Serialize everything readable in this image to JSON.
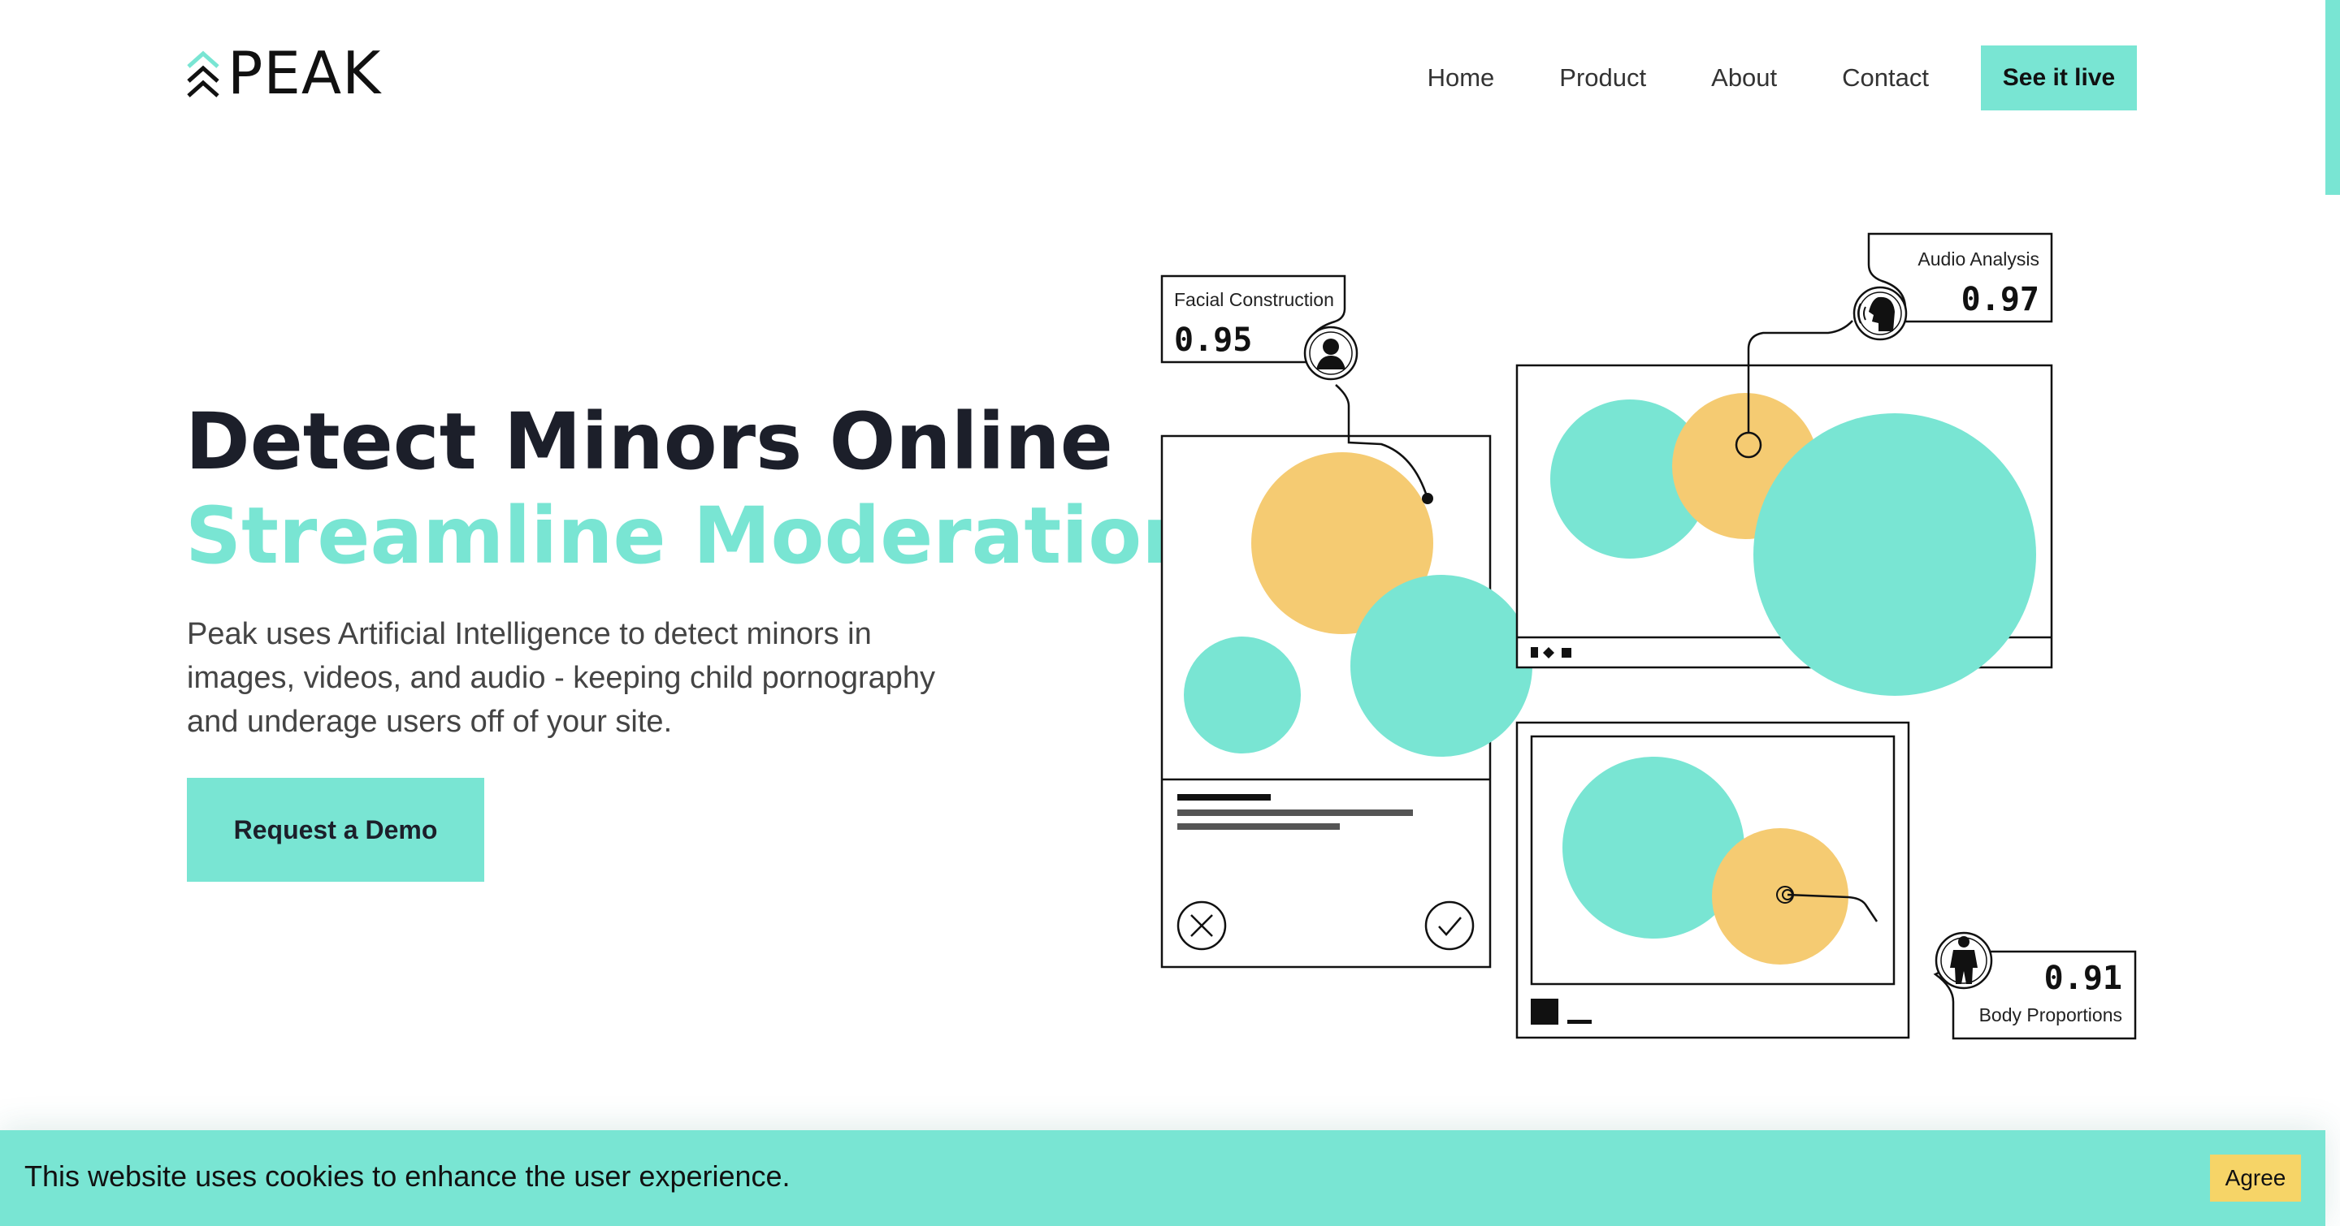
{
  "brand": {
    "name": "PEAK",
    "accent_color": "#79e5d3",
    "highlight_color": "#f5cb72"
  },
  "nav": {
    "items": [
      {
        "label": "Home"
      },
      {
        "label": "Product"
      },
      {
        "label": "About"
      },
      {
        "label": "Contact"
      }
    ],
    "cta_label": "See it live"
  },
  "hero": {
    "title": "Detect Minors Online",
    "subtitle": "Streamline Moderation",
    "description": "Peak uses Artificial Intelligence to detect minors in images, videos, and audio - keeping child pornography and underage users off of your site.",
    "cta_label": "Request a Demo"
  },
  "illustration": {
    "cards": [
      {
        "label": "Facial Construction",
        "value": "0.95",
        "icon": "person-head-icon"
      },
      {
        "label": "Audio Analysis",
        "value": "0.97",
        "icon": "speaking-head-icon"
      },
      {
        "label": "Body Proportions",
        "value": "0.91",
        "icon": "body-silhouette-icon"
      }
    ]
  },
  "cookie_banner": {
    "text": "This website uses cookies to enhance the user experience.",
    "agree_label": "Agree",
    "button_color": "#f6d467"
  }
}
